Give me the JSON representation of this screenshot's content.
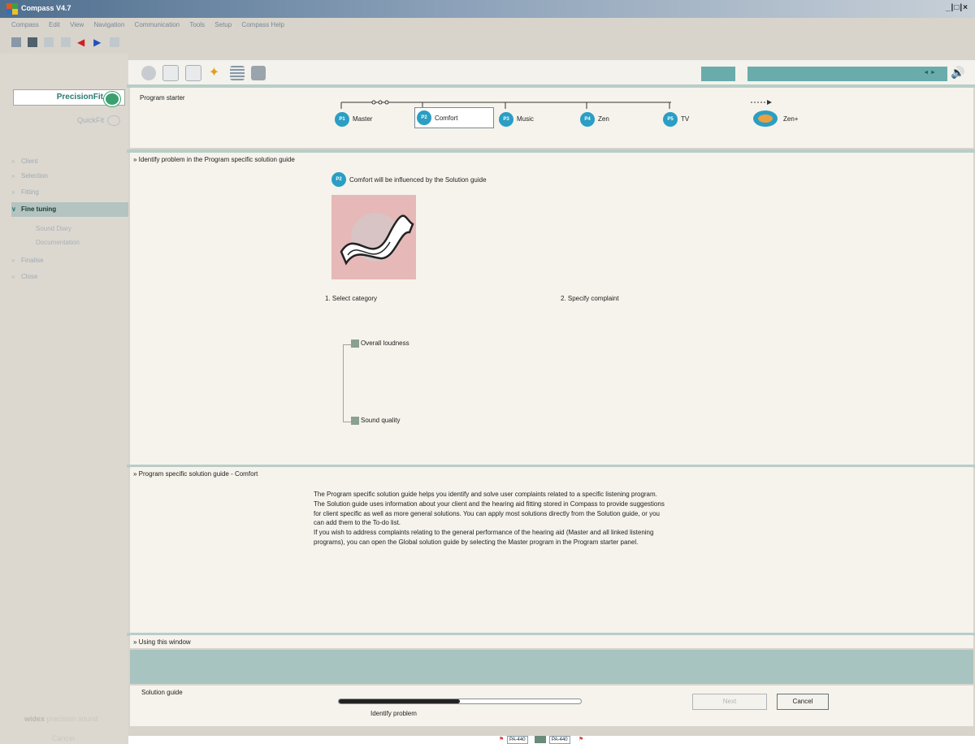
{
  "window": {
    "title": "Compass V4.7",
    "controls": "_|□|×"
  },
  "menu": [
    "Compass",
    "Edit",
    "View",
    "Navigation",
    "Communication",
    "Tools",
    "Setup",
    "Compass Help"
  ],
  "left_nav": {
    "modes": [
      {
        "label": "PrecisionFit",
        "active": true
      },
      {
        "label": "QuickFit",
        "active": false
      }
    ],
    "steps": [
      {
        "label": "Client",
        "marker": "»",
        "selected": false
      },
      {
        "label": "Selection",
        "marker": "»",
        "selected": false
      },
      {
        "label": "Fitting",
        "marker": "»",
        "selected": false
      },
      {
        "label": "Fine tuning",
        "marker": "∨",
        "selected": true
      },
      {
        "label": "Finalise",
        "marker": "»",
        "selected": false
      },
      {
        "label": "Close",
        "marker": "»",
        "selected": false
      }
    ],
    "fine_tuning_sub": [
      "Sound Diary",
      "Documentation"
    ],
    "brand": "widex",
    "brand_tail": "precision sound",
    "cancel": "Cancel"
  },
  "program_starter": {
    "title": "Program starter",
    "programs": [
      {
        "badge": "P1",
        "label": "Master"
      },
      {
        "badge": "P2",
        "label": "Comfort",
        "selected": true
      },
      {
        "badge": "P3",
        "label": "Music"
      },
      {
        "badge": "P4",
        "label": "Zen"
      },
      {
        "badge": "P5",
        "label": "TV"
      },
      {
        "badge": "",
        "label": "Zen+"
      }
    ]
  },
  "identify": {
    "title": "Identify problem in the Program specific solution guide",
    "badge": "P2",
    "note": "Comfort will be influenced by the Solution guide",
    "step1": "1. Select category",
    "step2": "2. Specify complaint",
    "categories": [
      "Overall loudness",
      "Sound quality"
    ]
  },
  "solution_guide": {
    "title": "Program specific solution guide - Comfort",
    "paragraph1": [
      "The Program specific solution guide helps you identify and solve user complaints related to a specific listening program.",
      "The Solution guide uses information about your client and the hearing aid fitting stored in Compass to provide suggestions",
      "for client specific as well as more general solutions. You can apply most solutions directly from the Solution guide, or you",
      "can add them to the To-do list."
    ],
    "paragraph2": [
      "If you wish to address complaints relating to the general performance of the hearing aid (Master and all linked listening",
      "programs), you can open the Global solution guide by selecting the Master program in the Program starter panel."
    ]
  },
  "using_window": {
    "title": "Using this window"
  },
  "bottom": {
    "title": "Solution guide",
    "progress_label": "Identify problem",
    "progress": 0.5,
    "next": "Next",
    "cancel": "Cancel"
  },
  "status": {
    "left_aid": "PA-440",
    "right_aid": "PA-440"
  },
  "colors": {
    "teal": "#6aacac",
    "program_blue": "#2a9ec4",
    "selected_nav": "#b4c4c0"
  }
}
